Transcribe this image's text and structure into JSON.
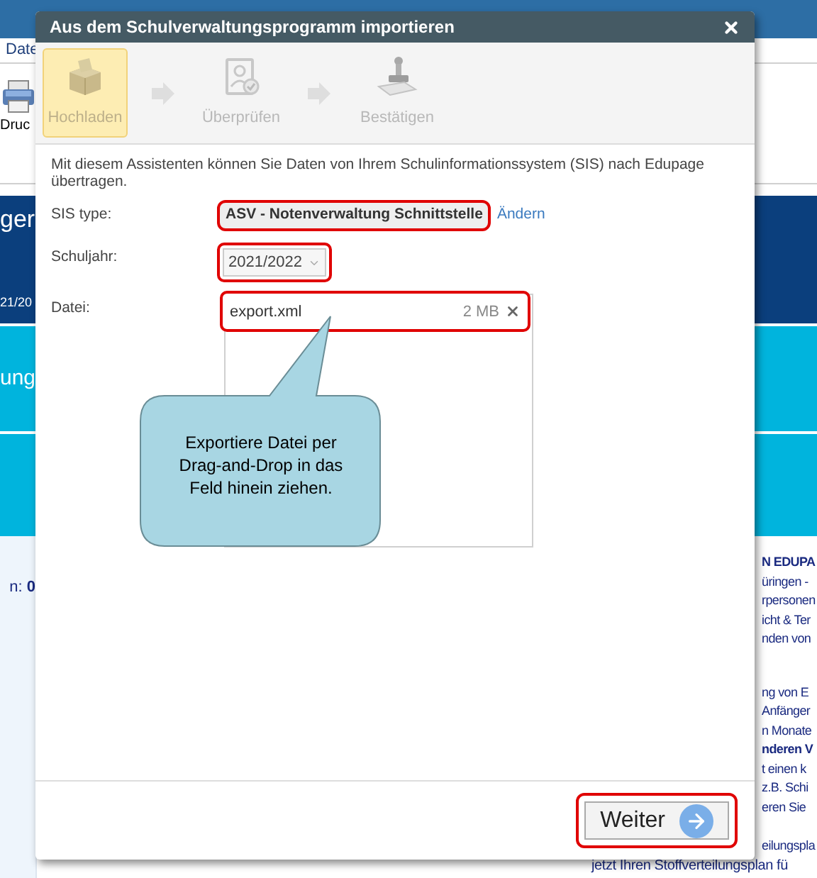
{
  "background": {
    "menu": "Date",
    "toolbar_button": "Druc",
    "banner_texts": [
      "ger",
      "21/20",
      "ung"
    ],
    "counter": {
      "label": "n:",
      "value": "0"
    },
    "news_lines": [
      {
        "text": "N EDUPA",
        "bold": true
      },
      {
        "text": "üringen -",
        "bold": false
      },
      {
        "text": "rpersonen",
        "bold": false
      },
      {
        "text": "icht & Ter",
        "bold": false
      },
      {
        "text": "nden von",
        "bold": false
      },
      {
        "text": "ng von E",
        "bold": false
      },
      {
        "text": "Anfänger",
        "bold": false
      },
      {
        "text": "n Monate",
        "bold": false
      },
      {
        "text": "nderen V",
        "bold": true
      },
      {
        "text": "t einen k",
        "bold": false
      },
      {
        "text": "z.B. Schi",
        "bold": false
      },
      {
        "text": "eren Sie",
        "bold": false
      },
      {
        "text": "eilungspla",
        "bold": false
      }
    ],
    "footer_line": "jetzt Ihren Stoffverteilungsplan fü"
  },
  "dialog": {
    "title": "Aus dem Schulverwaltungsprogramm importieren",
    "steps": [
      {
        "label": "Hochladen",
        "selected": true
      },
      {
        "label": "Überprüfen",
        "selected": false
      },
      {
        "label": "Bestätigen",
        "selected": false
      }
    ],
    "intro": "Mit diesem Assistenten können Sie Daten von Ihrem Schulinformationssystem (SIS) nach Edupage übertragen.",
    "fields": [
      {
        "kind": "text",
        "label": "SIS type:",
        "value": "ASV - Notenverwaltung Schnittstelle",
        "link": "Ändern"
      },
      {
        "kind": "select",
        "label": "Schuljahr:",
        "value": "2021/2022"
      },
      {
        "kind": "file",
        "label": "Datei:",
        "file_name": "export.xml",
        "file_size": "2 MB"
      }
    ],
    "callout": "Exportiere Datei per Drag-and-Drop in das Feld hinein ziehen.",
    "next_button": "Weiter"
  }
}
